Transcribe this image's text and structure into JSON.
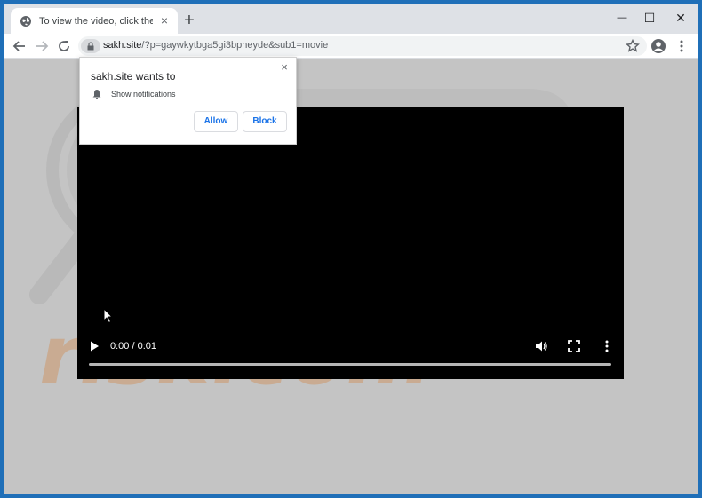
{
  "tab": {
    "title": "To view the video, click the Allow",
    "favicon": "globe-icon",
    "close": "×"
  },
  "new_tab": "+",
  "window_controls": {
    "minimize": "—",
    "maximize": "☐",
    "close": "✕"
  },
  "address_bar": {
    "domain": "sakh.site",
    "path": "/?p=gaywkytbga5gi3bpheyde&sub1=movie"
  },
  "notification_prompt": {
    "title": "sakh.site wants to",
    "permission": "Show notifications",
    "allow": "Allow",
    "block": "Block",
    "close": "×"
  },
  "video_player": {
    "time": "0:00 / 0:01",
    "progress": 0
  },
  "colors": {
    "accent": "#1a73e8",
    "window_border": "#1f6fb8",
    "titlebar": "#dee1e6",
    "page_background": "#c4c4c4"
  }
}
